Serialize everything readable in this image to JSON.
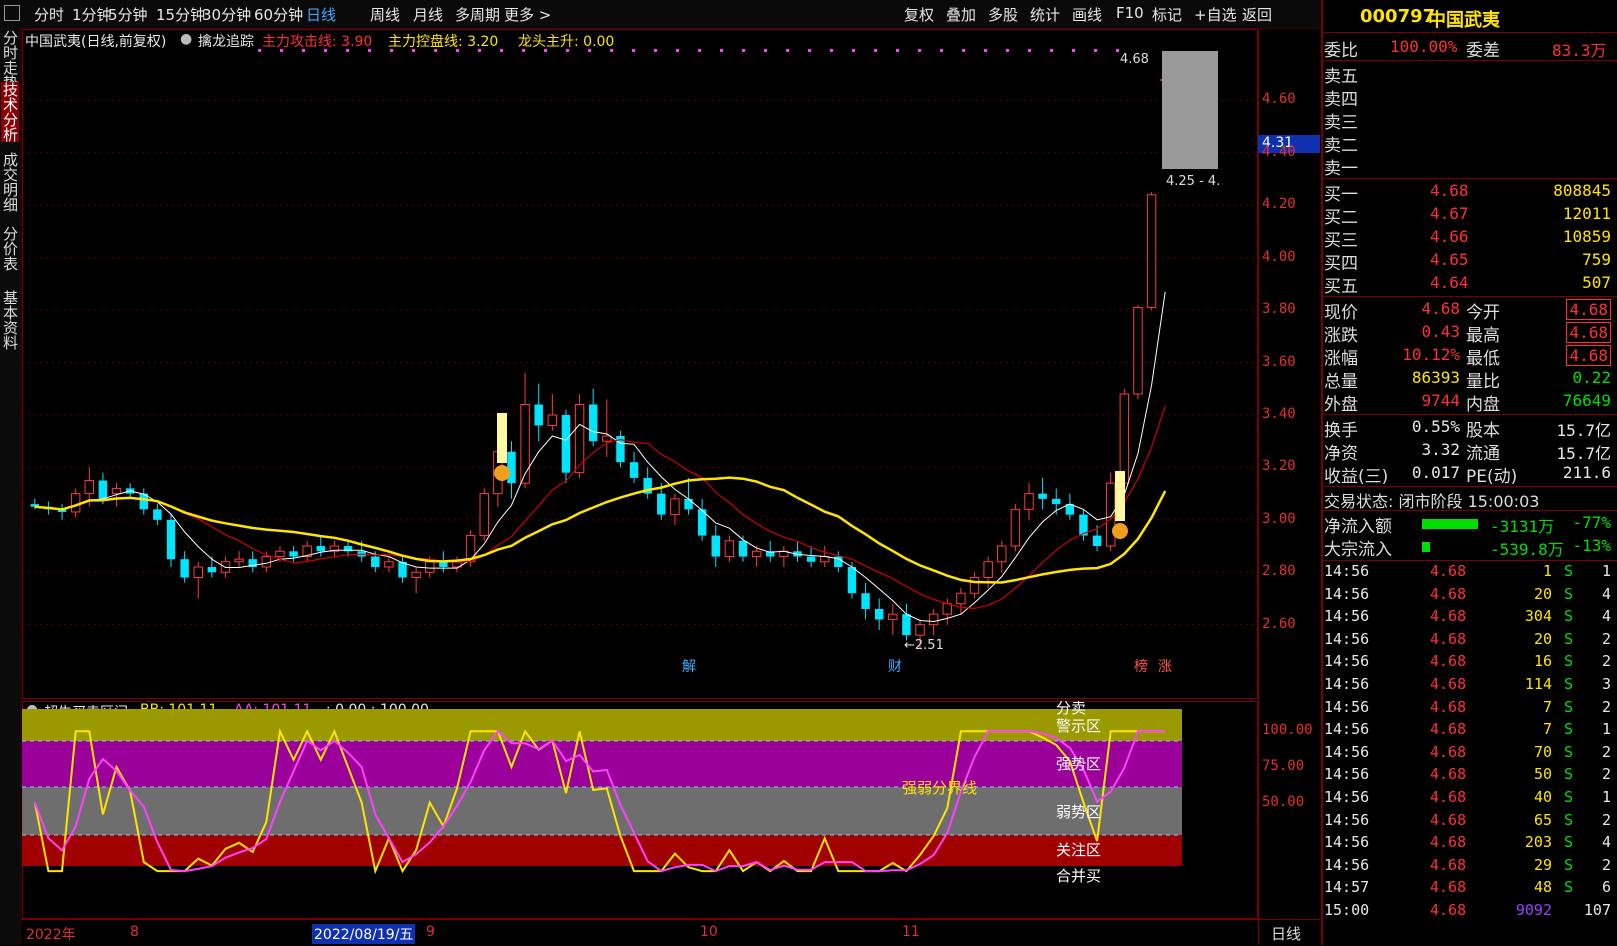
{
  "toolbar": {
    "left_items": [
      "分时",
      "1分钟",
      "5分钟",
      "15分钟",
      "30分钟",
      "60分钟",
      "日线",
      "周线",
      "月线",
      "多周期",
      "更多 >"
    ],
    "active_item": "日线",
    "right_items": [
      "复权",
      "叠加",
      "多股",
      "统计",
      "画线",
      "F10",
      "标记",
      "+自选",
      "返回"
    ]
  },
  "left_tabs": [
    {
      "label": "分时走势",
      "active": false
    },
    {
      "label": "技术分析",
      "active": true
    },
    {
      "label": "成交明细",
      "active": false
    },
    {
      "label": "分价表",
      "active": false
    },
    {
      "label": "基本资料",
      "active": false
    }
  ],
  "main_chart": {
    "stock_label": "中国武夷(日线,前复权)",
    "indicator_name": "擒龙追踪",
    "ind1_label": "主力攻击线: 3.90",
    "ind2_label": "主力控盘线: 3.20",
    "ind3_label": "龙头主升: 0.00",
    "high_marker": "4.68",
    "low_marker": "2.51",
    "range_label": "4.25 - 4.",
    "current_price_tag": "4.31",
    "y_ticks": [
      "4.60",
      "4.40",
      "4.20",
      "4.00",
      "3.80",
      "3.60",
      "3.40",
      "3.20",
      "3.00",
      "2.80",
      "2.60"
    ],
    "event_markers": [
      "解",
      "财",
      "榜",
      "涨"
    ]
  },
  "sub_chart": {
    "title": "超牛买卖区间",
    "bb_label": "BB: 101.11",
    "aa_label": "AA: 101.11",
    "extra_label": ": 0.00 : 100.00",
    "zone_labels": {
      "top": "分卖",
      "warn": "警示区",
      "strong": "强势区",
      "divider": "强弱分界线",
      "weak": "弱势区",
      "focus": "关注区",
      "buy": "合并买"
    },
    "y_ticks": [
      "100.00",
      "75.00",
      "50.00"
    ]
  },
  "date_bar": {
    "labels": [
      "2022年",
      "8",
      "2022/08/19/五",
      "9",
      "10",
      "11"
    ],
    "period": "日线"
  },
  "quote_panel": {
    "code": "000797",
    "name": "中国武夷",
    "weibi_label": "委比",
    "weibi_value": "100.00%",
    "weicha_label": "委差",
    "weicha_value": "83.3万",
    "sell_levels": [
      "卖五",
      "卖四",
      "卖三",
      "卖二",
      "卖一"
    ],
    "buy_levels": [
      {
        "label": "买一",
        "price": "4.68",
        "vol": "808845"
      },
      {
        "label": "买二",
        "price": "4.67",
        "vol": "12011"
      },
      {
        "label": "买三",
        "price": "4.66",
        "vol": "10859"
      },
      {
        "label": "买四",
        "price": "4.65",
        "vol": "759"
      },
      {
        "label": "买五",
        "price": "4.64",
        "vol": "507"
      }
    ],
    "stats": [
      {
        "l1": "现价",
        "v1": "4.68",
        "l2": "今开",
        "v2": "4.68"
      },
      {
        "l1": "涨跌",
        "v1": "0.43",
        "l2": "最高",
        "v2": "4.68"
      },
      {
        "l1": "涨幅",
        "v1": "10.12%",
        "l2": "最低",
        "v2": "4.68"
      },
      {
        "l1": "总量",
        "v1": "86393",
        "l2": "量比",
        "v2": "0.22"
      },
      {
        "l1": "外盘",
        "v1": "9744",
        "l2": "内盘",
        "v2": "76649"
      }
    ],
    "stats2": [
      {
        "l1": "换手",
        "v1": "0.55%",
        "l2": "股本",
        "v2": "15.7亿"
      },
      {
        "l1": "净资",
        "v1": "3.32",
        "l2": "流通",
        "v2": "15.7亿"
      },
      {
        "l1": "收益(三)",
        "v1": "0.017",
        "l2": "PE(动)",
        "v2": "211.6"
      }
    ],
    "trade_status": "交易状态: 闭市阶段 15:00:03",
    "net_inflow": {
      "label": "净流入额",
      "value": "-3131万",
      "pct": "-77%"
    },
    "block_inflow": {
      "label": "大宗流入",
      "value": "-539.8万",
      "pct": "-13%"
    },
    "ticks": [
      {
        "t": "14:56",
        "p": "4.68",
        "v": "1",
        "s": "S",
        "n": "1"
      },
      {
        "t": "14:56",
        "p": "4.68",
        "v": "20",
        "s": "S",
        "n": "4"
      },
      {
        "t": "14:56",
        "p": "4.68",
        "v": "304",
        "s": "S",
        "n": "4"
      },
      {
        "t": "14:56",
        "p": "4.68",
        "v": "20",
        "s": "S",
        "n": "2"
      },
      {
        "t": "14:56",
        "p": "4.68",
        "v": "16",
        "s": "S",
        "n": "2"
      },
      {
        "t": "14:56",
        "p": "4.68",
        "v": "114",
        "s": "S",
        "n": "3"
      },
      {
        "t": "14:56",
        "p": "4.68",
        "v": "7",
        "s": "S",
        "n": "2"
      },
      {
        "t": "14:56",
        "p": "4.68",
        "v": "7",
        "s": "S",
        "n": "1"
      },
      {
        "t": "14:56",
        "p": "4.68",
        "v": "70",
        "s": "S",
        "n": "2"
      },
      {
        "t": "14:56",
        "p": "4.68",
        "v": "50",
        "s": "S",
        "n": "2"
      },
      {
        "t": "14:56",
        "p": "4.68",
        "v": "40",
        "s": "S",
        "n": "1"
      },
      {
        "t": "14:56",
        "p": "4.68",
        "v": "65",
        "s": "S",
        "n": "2"
      },
      {
        "t": "14:56",
        "p": "4.68",
        "v": "203",
        "s": "S",
        "n": "4"
      },
      {
        "t": "14:56",
        "p": "4.68",
        "v": "29",
        "s": "S",
        "n": "2"
      },
      {
        "t": "14:57",
        "p": "4.68",
        "v": "48",
        "s": "S",
        "n": "6"
      },
      {
        "t": "15:00",
        "p": "4.68",
        "v": "9092",
        "s": "",
        "n": "107"
      }
    ]
  },
  "chart_data": {
    "type": "candlestick",
    "candles": [
      [
        3.06,
        3.08,
        3.04,
        3.05
      ],
      [
        3.05,
        3.07,
        3.02,
        3.04
      ],
      [
        3.04,
        3.06,
        3.0,
        3.03
      ],
      [
        3.03,
        3.12,
        3.01,
        3.1
      ],
      [
        3.1,
        3.2,
        3.05,
        3.15
      ],
      [
        3.15,
        3.18,
        3.06,
        3.08
      ],
      [
        3.1,
        3.14,
        3.05,
        3.12
      ],
      [
        3.12,
        3.14,
        3.08,
        3.1
      ],
      [
        3.1,
        3.12,
        3.02,
        3.04
      ],
      [
        3.04,
        3.06,
        2.98,
        3.0
      ],
      [
        3.0,
        3.02,
        2.82,
        2.85
      ],
      [
        2.85,
        2.88,
        2.76,
        2.78
      ],
      [
        2.78,
        2.84,
        2.7,
        2.82
      ],
      [
        2.82,
        2.86,
        2.78,
        2.8
      ],
      [
        2.8,
        2.86,
        2.78,
        2.84
      ],
      [
        2.84,
        2.88,
        2.82,
        2.85
      ],
      [
        2.85,
        2.88,
        2.8,
        2.82
      ],
      [
        2.82,
        2.88,
        2.8,
        2.86
      ],
      [
        2.86,
        2.9,
        2.84,
        2.88
      ],
      [
        2.88,
        2.9,
        2.84,
        2.86
      ],
      [
        2.86,
        2.92,
        2.84,
        2.9
      ],
      [
        2.9,
        2.94,
        2.86,
        2.88
      ],
      [
        2.88,
        2.92,
        2.86,
        2.9
      ],
      [
        2.9,
        2.92,
        2.86,
        2.88
      ],
      [
        2.88,
        2.92,
        2.84,
        2.86
      ],
      [
        2.86,
        2.88,
        2.8,
        2.82
      ],
      [
        2.82,
        2.86,
        2.8,
        2.84
      ],
      [
        2.84,
        2.86,
        2.76,
        2.78
      ],
      [
        2.78,
        2.82,
        2.72,
        2.8
      ],
      [
        2.8,
        2.86,
        2.78,
        2.84
      ],
      [
        2.84,
        2.88,
        2.8,
        2.82
      ],
      [
        2.82,
        2.86,
        2.8,
        2.84
      ],
      [
        2.84,
        2.96,
        2.82,
        2.94
      ],
      [
        2.94,
        3.12,
        2.92,
        3.1
      ],
      [
        3.1,
        3.3,
        3.05,
        3.26
      ],
      [
        3.26,
        3.3,
        3.08,
        3.14
      ],
      [
        3.14,
        3.56,
        3.12,
        3.44
      ],
      [
        3.44,
        3.52,
        3.3,
        3.36
      ],
      [
        3.36,
        3.48,
        3.34,
        3.4
      ],
      [
        3.4,
        3.42,
        3.14,
        3.18
      ],
      [
        3.18,
        3.48,
        3.16,
        3.44
      ],
      [
        3.44,
        3.5,
        3.28,
        3.3
      ],
      [
        3.3,
        3.46,
        3.24,
        3.32
      ],
      [
        3.32,
        3.34,
        3.2,
        3.22
      ],
      [
        3.22,
        3.26,
        3.14,
        3.16
      ],
      [
        3.16,
        3.2,
        3.08,
        3.1
      ],
      [
        3.1,
        3.14,
        3.0,
        3.02
      ],
      [
        3.02,
        3.1,
        2.98,
        3.08
      ],
      [
        3.08,
        3.16,
        3.02,
        3.04
      ],
      [
        3.04,
        3.08,
        2.92,
        2.94
      ],
      [
        2.94,
        2.98,
        2.82,
        2.86
      ],
      [
        2.86,
        2.94,
        2.84,
        2.92
      ],
      [
        2.92,
        2.94,
        2.84,
        2.86
      ],
      [
        2.86,
        2.9,
        2.82,
        2.88
      ],
      [
        2.88,
        2.92,
        2.84,
        2.86
      ],
      [
        2.86,
        2.9,
        2.82,
        2.88
      ],
      [
        2.88,
        2.92,
        2.84,
        2.86
      ],
      [
        2.86,
        2.9,
        2.82,
        2.84
      ],
      [
        2.84,
        2.9,
        2.82,
        2.86
      ],
      [
        2.86,
        2.88,
        2.8,
        2.82
      ],
      [
        2.82,
        2.84,
        2.7,
        2.72
      ],
      [
        2.72,
        2.76,
        2.62,
        2.66
      ],
      [
        2.66,
        2.7,
        2.58,
        2.62
      ],
      [
        2.62,
        2.68,
        2.56,
        2.64
      ],
      [
        2.64,
        2.68,
        2.54,
        2.56
      ],
      [
        2.56,
        2.62,
        2.51,
        2.6
      ],
      [
        2.6,
        2.66,
        2.56,
        2.64
      ],
      [
        2.64,
        2.7,
        2.6,
        2.68
      ],
      [
        2.68,
        2.74,
        2.64,
        2.72
      ],
      [
        2.72,
        2.8,
        2.7,
        2.78
      ],
      [
        2.78,
        2.86,
        2.74,
        2.84
      ],
      [
        2.84,
        2.92,
        2.8,
        2.9
      ],
      [
        2.9,
        3.06,
        2.88,
        3.04
      ],
      [
        3.04,
        3.14,
        3.0,
        3.1
      ],
      [
        3.1,
        3.16,
        3.04,
        3.08
      ],
      [
        3.08,
        3.12,
        3.02,
        3.06
      ],
      [
        3.06,
        3.1,
        3.0,
        3.02
      ],
      [
        3.02,
        3.04,
        2.92,
        2.94
      ],
      [
        2.94,
        2.98,
        2.88,
        2.9
      ],
      [
        2.9,
        3.18,
        2.88,
        3.14
      ],
      [
        3.14,
        3.5,
        3.12,
        3.48
      ],
      [
        3.48,
        3.82,
        3.46,
        3.81
      ],
      [
        3.81,
        4.25,
        3.8,
        4.24
      ],
      [
        4.68,
        4.68,
        4.68,
        4.68
      ]
    ],
    "ylim": [
      2.45,
      4.72
    ],
    "sub_ylim": [
      0,
      110
    ]
  }
}
